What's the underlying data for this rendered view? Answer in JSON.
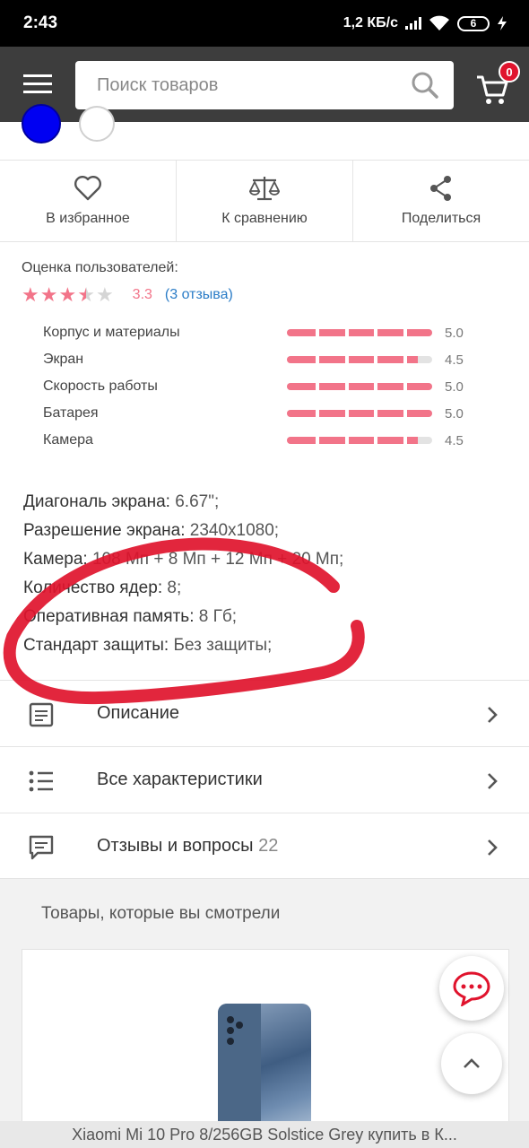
{
  "status_bar": {
    "time": "2:43",
    "network_speed": "1,2 КБ/с",
    "battery_level": "6"
  },
  "header": {
    "search_placeholder": "Поиск товаров",
    "cart_count": "0",
    "accent_color": "#e0132d"
  },
  "color_options": [
    {
      "color": "#0000f2",
      "selected": true
    },
    {
      "color": "#ffffff",
      "selected": false
    }
  ],
  "actions": {
    "favorite_label": "В избранное",
    "compare_label": "К сравнению",
    "share_label": "Поделиться"
  },
  "rating": {
    "title": "Оценка пользователей:",
    "value": "3.3",
    "stars": 3.5,
    "reviews_link": "(3 отзыва)",
    "star_color": "#f27489",
    "criteria": [
      {
        "label": "Корпус и материалы",
        "score": "5.0",
        "fraction": 1.0
      },
      {
        "label": "Экран",
        "score": "4.5",
        "fraction": 0.9
      },
      {
        "label": "Скорость работы",
        "score": "5.0",
        "fraction": 1.0
      },
      {
        "label": "Батарея",
        "score": "5.0",
        "fraction": 1.0
      },
      {
        "label": "Камера",
        "score": "4.5",
        "fraction": 0.9
      }
    ]
  },
  "specs": [
    {
      "name": "Диагональ экрана:",
      "value": "6.67\";"
    },
    {
      "name": "Разрешение экрана:",
      "value": "2340x1080;"
    },
    {
      "name": "Камера:",
      "value": "108 Мп + 8 Мп + 12 Мп + 20 Мп;"
    },
    {
      "name": "Количество ядер:",
      "value": "8;"
    },
    {
      "name": "Оперативная память:",
      "value": "8 Гб;"
    },
    {
      "name": "Стандарт защиты:",
      "value": "Без защиты;"
    }
  ],
  "menu": {
    "description_label": "Описание",
    "characteristics_label": "Все характеристики",
    "reviews_label": "Отзывы и вопросы",
    "reviews_count": "22"
  },
  "viewed": {
    "title": "Товары, которые вы смотрели"
  },
  "bottom_bar": {
    "page_title": "Xiaomi Mi 10 Pro 8/256GB Solstice Grey купить в К..."
  }
}
